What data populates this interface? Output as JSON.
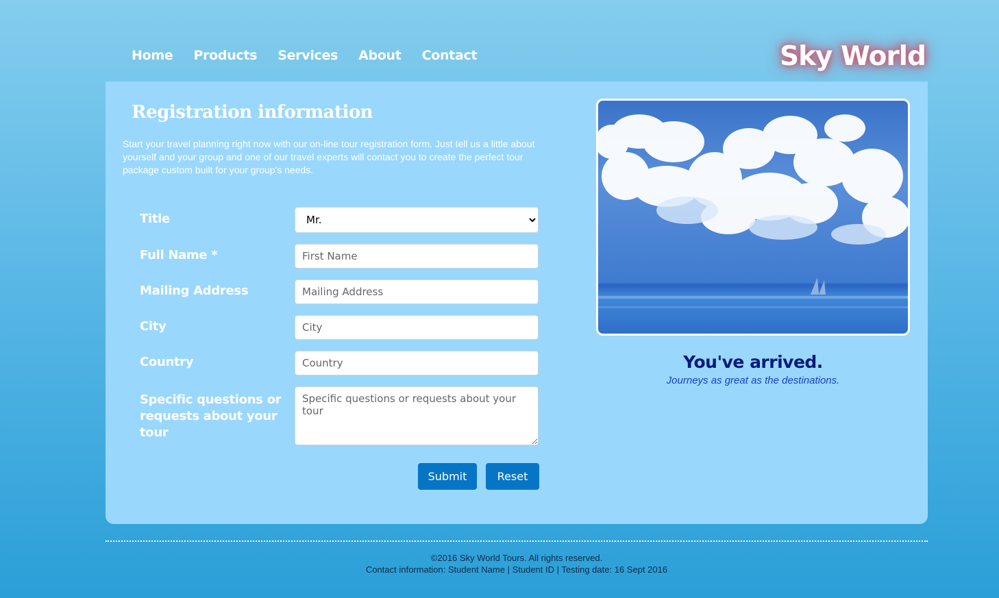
{
  "nav": {
    "items": [
      {
        "label": "Home"
      },
      {
        "label": "Products"
      },
      {
        "label": "Services"
      },
      {
        "label": "About"
      },
      {
        "label": "Contact"
      }
    ],
    "logo": "Sky World"
  },
  "form": {
    "heading": "Registration information",
    "intro": "Start your travel planning right now with our on-line tour registration form. Just tell us a little about yourself and your group and one of our travel experts will contact you to create the perfect tour package custom built for your group's needs.",
    "title": {
      "label": "Title",
      "selected": "Mr."
    },
    "full_name": {
      "label": "Full Name *",
      "placeholder": "First Name"
    },
    "mailing_address": {
      "label": "Mailing Address",
      "placeholder": "Mailing Address"
    },
    "city": {
      "label": "City",
      "placeholder": "City"
    },
    "country": {
      "label": "Country",
      "placeholder": "Country"
    },
    "questions": {
      "label": "Specific questions or requests about your tour",
      "placeholder": "Specific questions or requests about your tour"
    },
    "submit_label": "Submit",
    "reset_label": "Reset"
  },
  "aside": {
    "headline": "You've arrived.",
    "tagline": "Journeys as great as the destinations."
  },
  "footer": {
    "copyright": "©2016 Sky World Tours. All rights reserved.",
    "contact": "Contact information: Student Name | Student ID | Testing date: 16 Sept 2016"
  }
}
